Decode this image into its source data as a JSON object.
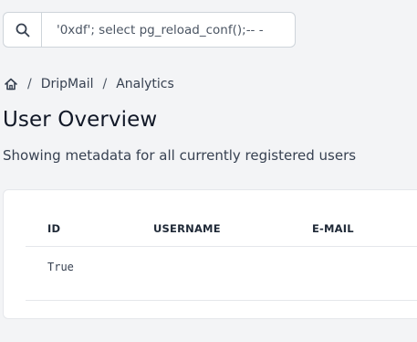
{
  "search": {
    "value": "'0xdf'; select pg_reload_conf();-- -"
  },
  "breadcrumb": {
    "items": [
      "DripMail",
      "Analytics"
    ],
    "separator": "/"
  },
  "page": {
    "title": "User Overview",
    "subtitle": "Showing metadata for all currently registered users"
  },
  "table": {
    "columns": [
      "ID",
      "USERNAME",
      "E-MAIL"
    ],
    "rows": [
      {
        "id": "True",
        "username": "",
        "email": ""
      }
    ]
  },
  "icons": {
    "search": "search-icon",
    "home": "home-icon"
  }
}
